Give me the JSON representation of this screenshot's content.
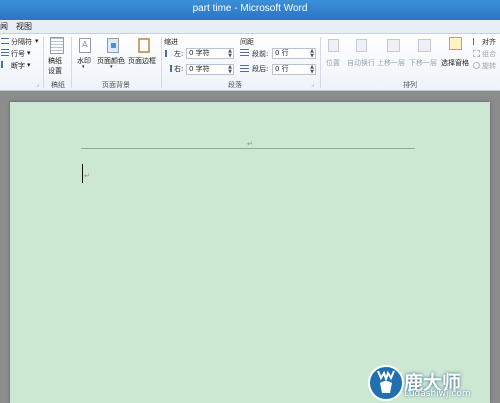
{
  "window": {
    "title": "part time - Microsoft Word"
  },
  "tabs": [
    {
      "label": "视图"
    }
  ],
  "ribbon": {
    "page_setup_partial": {
      "breaks": "分隔符",
      "line_numbers": "行号",
      "hyphenation": "断字"
    },
    "manuscript": {
      "button_line1": "稿纸",
      "button_line2": "设置",
      "group_label": "稿纸"
    },
    "page_background": {
      "watermark": "水印",
      "page_color": "页面颜色",
      "page_borders": "页面边框",
      "group_label": "页面背景"
    },
    "paragraph": {
      "indent_title": "缩进",
      "left_label": "左:",
      "left_value": "0 字符",
      "right_label": "右:",
      "right_value": "0 字符",
      "spacing_title": "间距",
      "before_label": "段前:",
      "before_value": "0 行",
      "after_label": "段后:",
      "after_value": "0 行",
      "group_label": "段落"
    },
    "arrange": {
      "position": "位置",
      "wrap_text": "自动换行",
      "bring_forward": "上移一层",
      "send_backward": "下移一层",
      "selection_pane": "选择窗格",
      "align": "对齐",
      "group": "组合",
      "rotate": "旋转",
      "group_label": "排列"
    }
  },
  "document": {
    "pilcrow": "↵"
  },
  "watermark": {
    "brand": "鹿大师",
    "site": "Ludashiwj.com"
  },
  "colors": {
    "title_bar": "#2b76c5",
    "page_background": "#cce8d2",
    "workspace": "#8c8c8c"
  }
}
